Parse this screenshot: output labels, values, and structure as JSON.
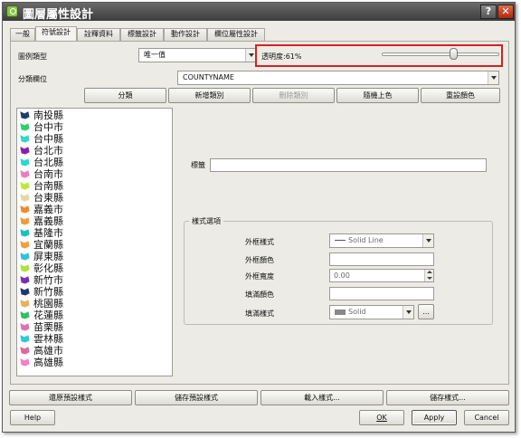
{
  "window": {
    "title": "圖層屬性設計",
    "help_glyph": "?",
    "close_glyph": "✕",
    "app_icon": "qgis-icon"
  },
  "tabs": [
    {
      "label": "一般",
      "active": false
    },
    {
      "label": "符號設計",
      "active": true
    },
    {
      "label": "詮釋資料",
      "active": false
    },
    {
      "label": "標籤設計",
      "active": false
    },
    {
      "label": "動作設計",
      "active": false
    },
    {
      "label": "欄位屬性設計",
      "active": false
    }
  ],
  "symbology": {
    "legend_type_label": "圖例類型",
    "legend_type_value": "唯一值",
    "transparency_label": "透明度:61%",
    "transparency_percent": 61,
    "classify_field_label": "分類欄位",
    "classify_field_value": "COUNTYNAME",
    "buttons": {
      "classify": "分類",
      "add_class": "新增類別",
      "delete_class": "刪除類別",
      "random_colors": "隨機上色",
      "reset_colors": "重設顏色"
    },
    "classes": [
      {
        "label": "南投縣",
        "color": "#1f3b6e"
      },
      {
        "label": "台中市",
        "color": "#2fd06b"
      },
      {
        "label": "台中縣",
        "color": "#35d8c8"
      },
      {
        "label": "台北市",
        "color": "#8a20a8"
      },
      {
        "label": "台北縣",
        "color": "#2ad8d0"
      },
      {
        "label": "台南市",
        "color": "#f07ac0"
      },
      {
        "label": "台南縣",
        "color": "#bde83a"
      },
      {
        "label": "台東縣",
        "color": "#e8d6a0"
      },
      {
        "label": "嘉義市",
        "color": "#f08a30"
      },
      {
        "label": "嘉義縣",
        "color": "#f09a3a"
      },
      {
        "label": "基隆市",
        "color": "#18c0c0"
      },
      {
        "label": "宜蘭縣",
        "color": "#f0a040"
      },
      {
        "label": "屏東縣",
        "color": "#30c0e0"
      },
      {
        "label": "彰化縣",
        "color": "#b0e040"
      },
      {
        "label": "新竹市",
        "color": "#7a30b0"
      },
      {
        "label": "新竹縣",
        "color": "#203a70"
      },
      {
        "label": "桃園縣",
        "color": "#e8b060"
      },
      {
        "label": "花蓮縣",
        "color": "#30c060"
      },
      {
        "label": "苗栗縣",
        "color": "#e070b0"
      },
      {
        "label": "雲林縣",
        "color": "#30c8d8"
      },
      {
        "label": "高雄市",
        "color": "#e06898"
      },
      {
        "label": "高雄縣",
        "color": "#f080c8"
      }
    ],
    "tag_label": "標籤",
    "tag_value": "",
    "style_options": {
      "group_title": "樣式選項",
      "outline_style_label": "外框樣式",
      "outline_style_value": "Solid Line",
      "outline_color_label": "外框顏色",
      "outline_width_label": "外框寬度",
      "outline_width_value": "0.00",
      "fill_color_label": "填滿顏色",
      "fill_style_label": "填滿樣式",
      "fill_style_value": "Solid",
      "more_button": "..."
    }
  },
  "footer": {
    "restore_default": "還原預設樣式",
    "save_default": "儲存預設樣式",
    "load_style": "載入樣式...",
    "save_style": "儲存樣式...",
    "help": "Help",
    "ok": "OK",
    "apply": "Apply",
    "cancel": "Cancel"
  },
  "colors": {
    "highlight": "#d82020",
    "titlebar": "#4a4a4a",
    "dialog_bg": "#ecebe6"
  }
}
